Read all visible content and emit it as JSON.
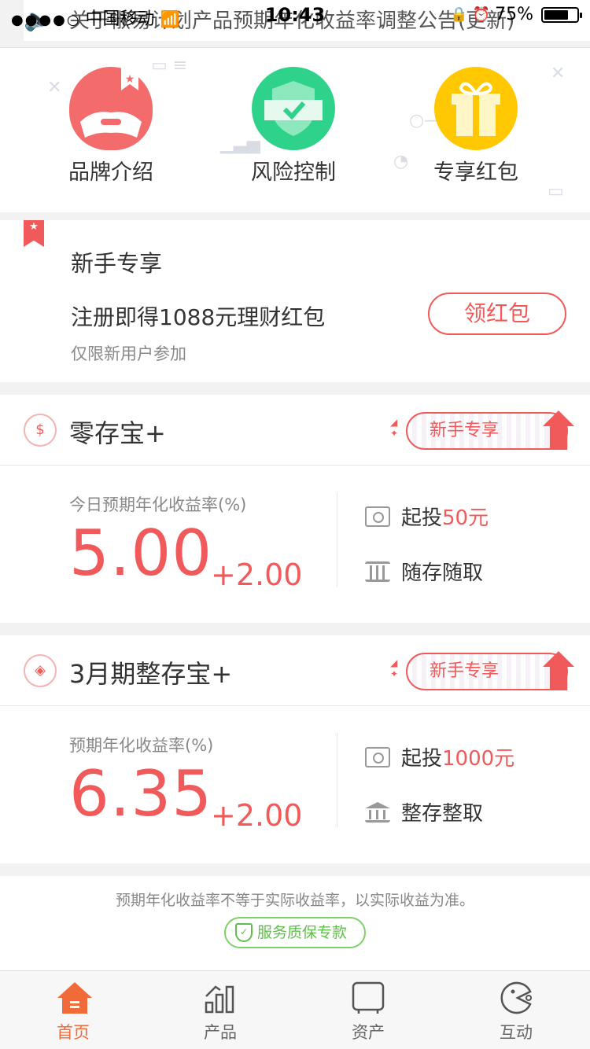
{
  "status_bar": {
    "carrier": "中国移动",
    "time": "10:43",
    "battery": "75%"
  },
  "notice": {
    "text": "关于椒易计划产品预期年化收益率调整公告(更新)"
  },
  "quick_entries": [
    {
      "label": "品牌介绍",
      "icon": "helmet-icon",
      "color": "#f36b6b"
    },
    {
      "label": "风险控制",
      "icon": "shield-icon",
      "color": "#2fd28a"
    },
    {
      "label": "专享红包",
      "icon": "gift-icon",
      "color": "#ffc800"
    }
  ],
  "newbie": {
    "title": "新手专享",
    "description": "注册即得1088元理财红包",
    "sub": "仅限新用户参加",
    "button": "领红包"
  },
  "products": [
    {
      "name": "零存宝+",
      "tag": "新手专享",
      "rate_label": "今日预期年化收益率(%)",
      "rate": "5.00",
      "bonus": "+2.00",
      "min_label": "起投",
      "min_amount": "50元",
      "feature": "随存随取"
    },
    {
      "name": "3月期整存宝+",
      "tag": "新手专享",
      "rate_label": "预期年化收益率(%)",
      "rate": "6.35",
      "bonus": "+2.00",
      "min_label": "起投",
      "min_amount": "1000元",
      "feature": "整存整取"
    }
  ],
  "footer": {
    "disclaimer": "预期年化收益率不等于实际收益率，以实际收益为准。",
    "guarantee": "服务质保专款"
  },
  "tabs": [
    {
      "label": "首页",
      "active": true
    },
    {
      "label": "产品",
      "active": false
    },
    {
      "label": "资产",
      "active": false
    },
    {
      "label": "互动",
      "active": false
    }
  ],
  "colors": {
    "accent": "#f05a5a",
    "green": "#2fd28a",
    "yellow": "#ffc800",
    "tab_active": "#f06a3a"
  }
}
